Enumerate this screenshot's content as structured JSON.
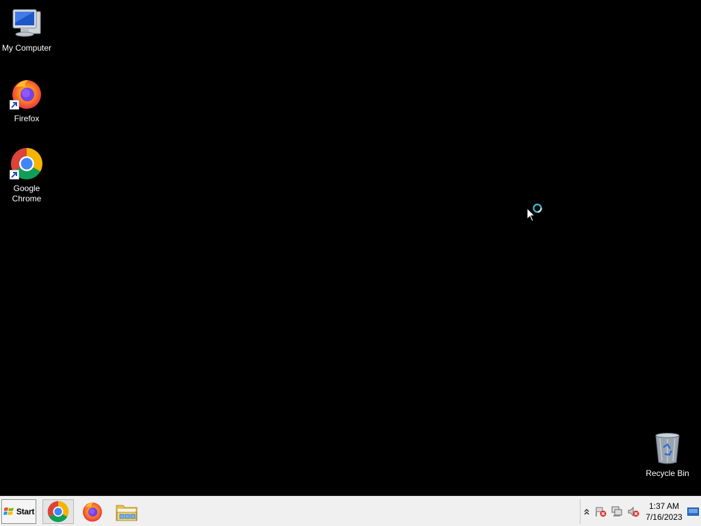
{
  "desktop": {
    "background": "#000000",
    "icons": [
      {
        "name": "my-computer",
        "label": "My Computer",
        "icon": "computer-monitor-icon"
      },
      {
        "name": "firefox",
        "label": "Firefox",
        "icon": "firefox-icon",
        "shortcut": true
      },
      {
        "name": "google-chrome",
        "label": "Google Chrome",
        "icon": "chrome-icon",
        "shortcut": true
      },
      {
        "name": "recycle-bin",
        "label": "Recycle Bin",
        "icon": "recycle-bin-icon"
      }
    ]
  },
  "cursor": {
    "state": "busy",
    "icon": "busy-pointer-icon"
  },
  "taskbar": {
    "start_label": "Start",
    "pinned": [
      {
        "name": "chrome",
        "icon": "chrome-icon",
        "active": true
      },
      {
        "name": "firefox",
        "icon": "firefox-icon"
      },
      {
        "name": "windows-explorer",
        "icon": "folder-icon"
      }
    ],
    "tray": {
      "icons": [
        "show-hidden-icons-chevron",
        "action-center-flag-icon",
        "network-disconnected-icon",
        "volume-muted-icon"
      ],
      "time": "1:37 AM",
      "date": "7/16/2023"
    }
  },
  "colors": {
    "taskbar": "#f0f0f0",
    "chrome_red": "#db4437",
    "chrome_green": "#0f9d58",
    "chrome_yellow": "#f4b400",
    "chrome_blue": "#4285f4"
  }
}
